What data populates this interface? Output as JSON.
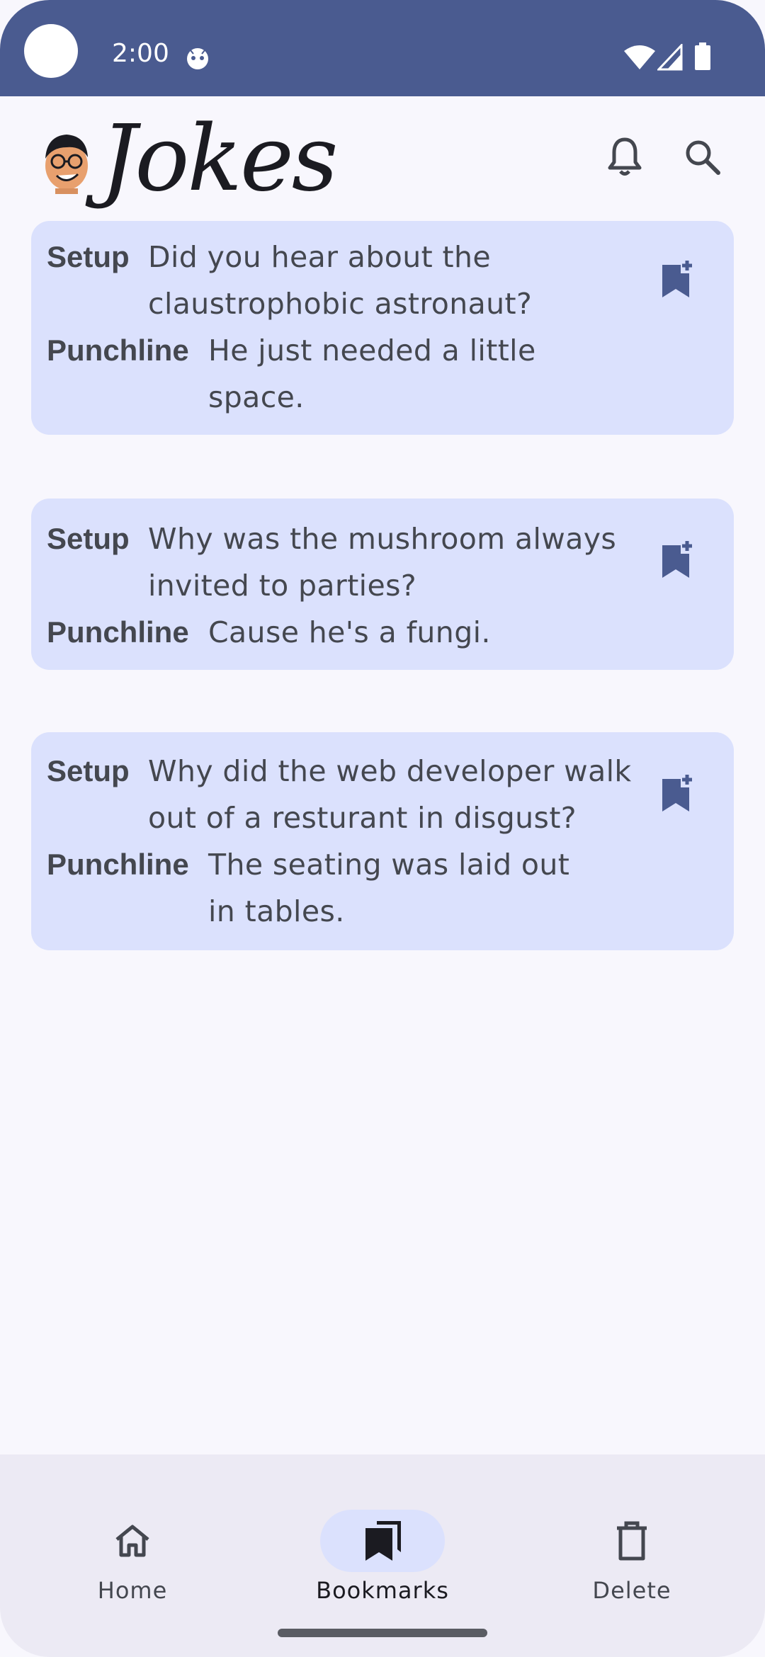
{
  "status_bar": {
    "time": "2:00",
    "icons": [
      "face-status-icon",
      "wifi-icon",
      "signal-icon",
      "battery-icon"
    ]
  },
  "header": {
    "title": "Jokes",
    "logo": "cartoon-face-logo",
    "actions": [
      "bell-icon",
      "search-icon"
    ]
  },
  "jokes": [
    {
      "setup_label": "Setup",
      "setup": "Did you hear about the claustrophobic astronaut?",
      "punchline_label": "Punchline",
      "punchline": "He just needed a little space.",
      "action_icon": "bookmark-add-icon"
    },
    {
      "setup_label": "Setup",
      "setup": "Why was the mushroom always invited to parties?",
      "punchline_label": "Punchline",
      "punchline": "Cause he's a fungi.",
      "action_icon": "bookmark-add-icon"
    },
    {
      "setup_label": "Setup",
      "setup": "Why did the web developer walk out of a resturant in disgust?",
      "punchline_label": "Punchline",
      "punchline": "The seating was laid out in tables.",
      "action_icon": "bookmark-add-icon"
    }
  ],
  "bottom_nav": {
    "selected": "Bookmarks",
    "items": [
      {
        "label": "Home",
        "icon": "home-icon"
      },
      {
        "label": "Bookmarks",
        "icon": "bookmarks-icon"
      },
      {
        "label": "Delete",
        "icon": "trash-icon"
      }
    ]
  },
  "colors": {
    "status_bar": "#4a5b90",
    "background": "#f8f7fd",
    "card": "#dbe1fd",
    "accent": "#4a5b90",
    "nav_bar": "#eceaf4",
    "text": "#44474f"
  }
}
